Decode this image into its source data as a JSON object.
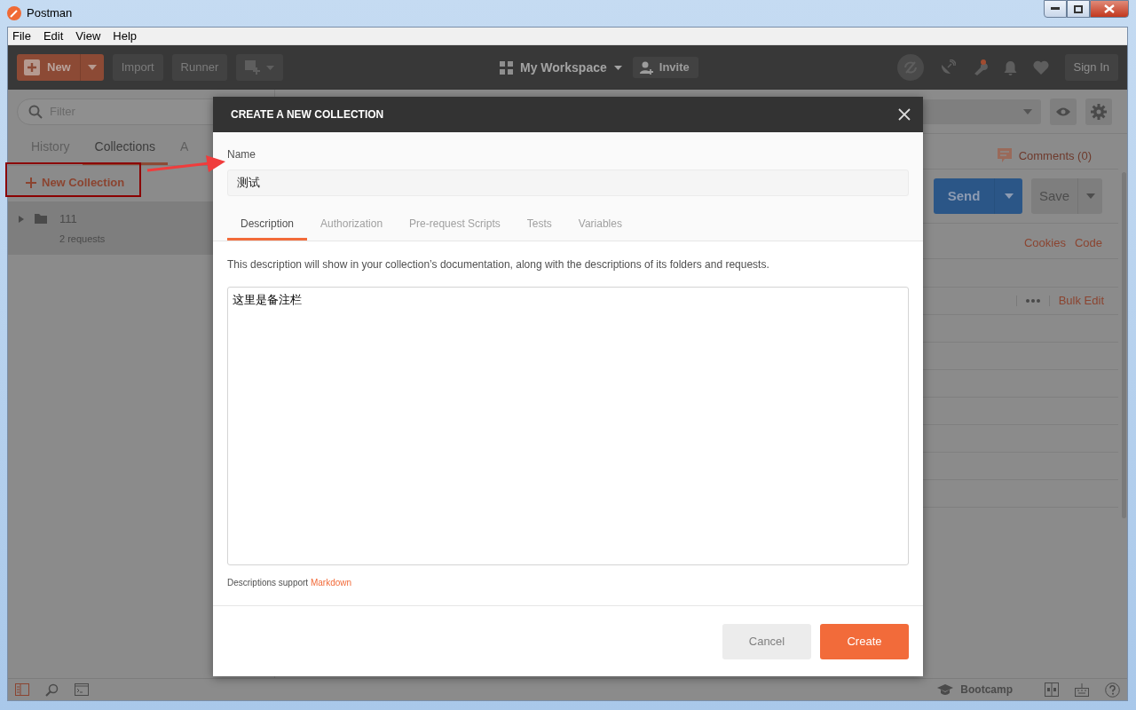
{
  "window": {
    "title": "Postman"
  },
  "menu": [
    "File",
    "Edit",
    "View",
    "Help"
  ],
  "toolbar": {
    "new_label": "New",
    "import_label": "Import",
    "runner_label": "Runner",
    "workspace": "My Workspace",
    "invite": "Invite",
    "sign_in": "Sign In"
  },
  "sidebar": {
    "filter_placeholder": "Filter",
    "tabs": [
      {
        "label": "History",
        "selected": false
      },
      {
        "label": "Collections",
        "selected": true
      },
      {
        "label": "A",
        "selected": false
      }
    ],
    "new_collection": "New Collection",
    "collections": [
      {
        "name": "111",
        "count": "2 requests"
      }
    ]
  },
  "request_pane": {
    "comments": "Comments (0)",
    "send": "Send",
    "save": "Save",
    "links": [
      "Cookies",
      "Code"
    ],
    "bulk_edit": "Bulk Edit"
  },
  "status_bar": {
    "bootcamp": "Bootcamp"
  },
  "modal": {
    "title": "CREATE A NEW COLLECTION",
    "name_label": "Name",
    "name_value": "测试",
    "tabs": [
      {
        "label": "Description",
        "selected": true
      },
      {
        "label": "Authorization",
        "selected": false
      },
      {
        "label": "Pre-request Scripts",
        "selected": false
      },
      {
        "label": "Tests",
        "selected": false
      },
      {
        "label": "Variables",
        "selected": false
      }
    ],
    "description_hint": "This description will show in your collection’s documentation, along with the descriptions of its folders and requests.",
    "description_value": "这里是备注栏",
    "footnote": "Descriptions support",
    "footnote_link": "Markdown",
    "buttons": [
      {
        "label": "Cancel",
        "kind": "secondary"
      },
      {
        "label": "Create",
        "kind": "primary"
      }
    ]
  }
}
